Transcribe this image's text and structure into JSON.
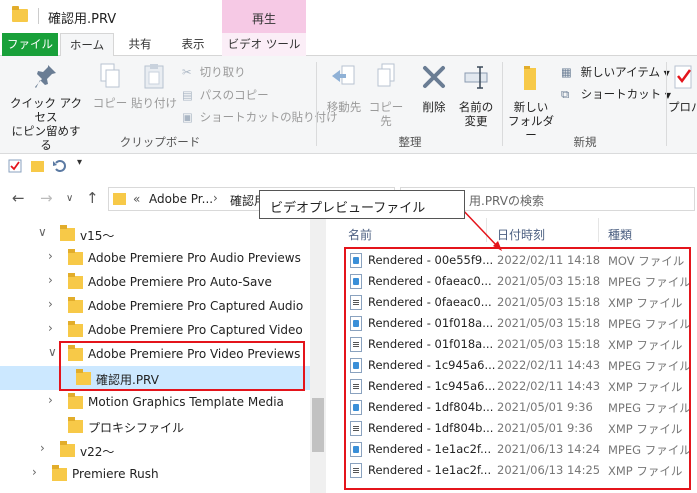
{
  "window": {
    "title": "確認用.PRV",
    "context_tab_group": "再生"
  },
  "ribbon_tabs": [
    "ファイル",
    "ホーム",
    "共有",
    "表示",
    "ビデオ ツール"
  ],
  "ribbon": {
    "clipboard": {
      "pin_label_1": "クイック アクセス",
      "pin_label_2": "にピン留めする",
      "copy": "コピー",
      "paste": "貼り付け",
      "cut": "切り取り",
      "copy_path": "パスのコピー",
      "paste_shortcut": "ショートカットの貼り付け",
      "group": "クリップボード"
    },
    "organize": {
      "move_to": "移動先",
      "copy_to": "コピー先",
      "delete": "削除",
      "rename_1": "名前の",
      "rename_2": "変更",
      "group": "整理"
    },
    "new": {
      "new_folder_1": "新しい",
      "new_folder_2": "フォルダー",
      "new_item": "新しいアイテム",
      "shortcut": "ショートカット",
      "group": "新規"
    },
    "open": {
      "properties": "プロパ"
    }
  },
  "address": {
    "prefix": "«",
    "seg1": "Adobe Pr...",
    "sep": "›",
    "seg2": "確認用",
    "search_placeholder": "用.PRVの検索"
  },
  "tree": {
    "items": [
      {
        "label": "v15〜",
        "expanded": true
      },
      {
        "label": "Adobe Premiere Pro Audio Previews"
      },
      {
        "label": "Adobe Premiere Pro Auto-Save"
      },
      {
        "label": "Adobe Premiere Pro Captured Audio"
      },
      {
        "label": "Adobe Premiere Pro Captured Video"
      },
      {
        "label": "Adobe Premiere Pro Video Previews",
        "expanded": true
      },
      {
        "label": "確認用.PRV",
        "selected": true
      },
      {
        "label": "Motion Graphics Template Media"
      },
      {
        "label": "プロキシファイル"
      },
      {
        "label": "v22〜"
      },
      {
        "label": "Premiere Rush"
      }
    ]
  },
  "filelist": {
    "columns": [
      "名前",
      "日付時刻",
      "種類"
    ],
    "rows": [
      {
        "name": "Rendered - 00e55f9...",
        "date": "2022/02/11 14:18",
        "type": "MOV ファイル",
        "icon": "media-file-icon"
      },
      {
        "name": "Rendered - 0faeac0...",
        "date": "2021/05/03 15:18",
        "type": "MPEG ファイル",
        "icon": "media-file-icon"
      },
      {
        "name": "Rendered - 0faeac0...",
        "date": "2021/05/03 15:18",
        "type": "XMP ファイル",
        "icon": "xml-file-icon"
      },
      {
        "name": "Rendered - 01f018a...",
        "date": "2021/05/03 15:18",
        "type": "MPEG ファイル",
        "icon": "media-file-icon"
      },
      {
        "name": "Rendered - 01f018a...",
        "date": "2021/05/03 15:18",
        "type": "XMP ファイル",
        "icon": "xml-file-icon"
      },
      {
        "name": "Rendered - 1c945a6...",
        "date": "2022/02/11 14:43",
        "type": "MPEG ファイル",
        "icon": "media-file-icon"
      },
      {
        "name": "Rendered - 1c945a6...",
        "date": "2022/02/11 14:43",
        "type": "XMP ファイル",
        "icon": "xml-file-icon"
      },
      {
        "name": "Rendered - 1df804b...",
        "date": "2021/05/01 9:36",
        "type": "MPEG ファイル",
        "icon": "media-file-icon"
      },
      {
        "name": "Rendered - 1df804b...",
        "date": "2021/05/01 9:36",
        "type": "XMP ファイル",
        "icon": "xml-file-icon"
      },
      {
        "name": "Rendered - 1e1ac2f...",
        "date": "2021/06/13 14:24",
        "type": "MPEG ファイル",
        "icon": "media-file-icon"
      },
      {
        "name": "Rendered - 1e1ac2f...",
        "date": "2021/06/13 14:25",
        "type": "XMP ファイル",
        "icon": "xml-file-icon"
      }
    ]
  },
  "annotation": {
    "callout_text": "ビデオプレビューファイル",
    "color": "#e4141b"
  }
}
